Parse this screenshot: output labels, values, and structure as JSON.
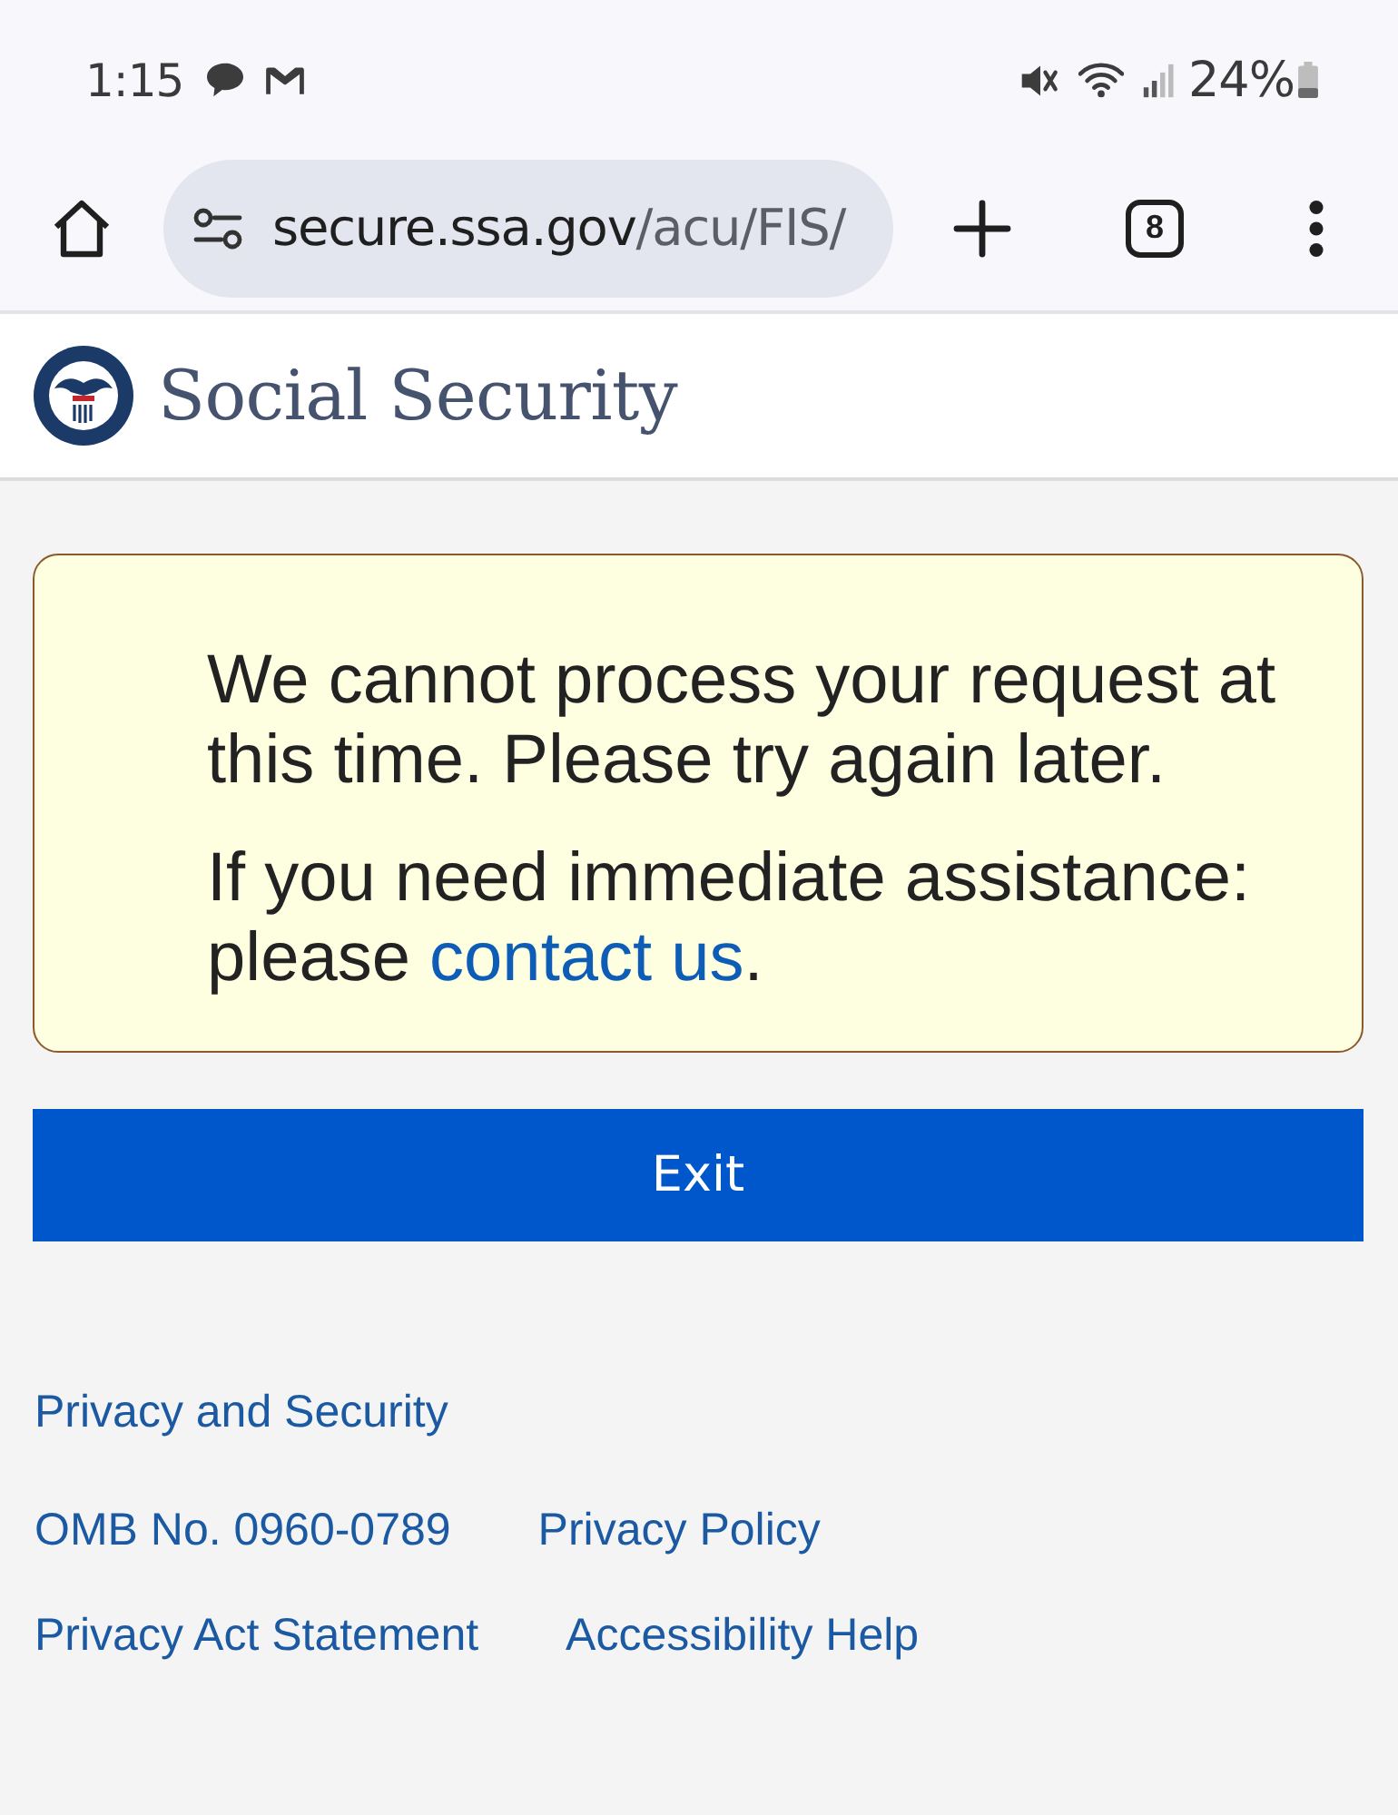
{
  "status_bar": {
    "time": "1:15",
    "battery": "24%"
  },
  "browser_toolbar": {
    "address_bar": {
      "host": "secure.ssa.gov",
      "path": "/acu/FIS/"
    },
    "tab_count": "8"
  },
  "site_header": {
    "title": "Social Security"
  },
  "alert": {
    "paragraphs": [
      {
        "segments": [
          {
            "kind": "text",
            "text": "We cannot process your request at this time. Please try again later."
          }
        ]
      },
      {
        "segments": [
          {
            "kind": "text",
            "text": "If you need immediate assistance: please "
          },
          {
            "kind": "link",
            "text": "contact us"
          },
          {
            "kind": "text",
            "text": "."
          }
        ]
      }
    ]
  },
  "exit_button": {
    "label": "Exit"
  },
  "footer": {
    "rows": [
      {
        "links": [
          {
            "label": "Privacy and Security"
          }
        ]
      },
      {
        "links": [
          {
            "label": "OMB No. 0960-0789"
          },
          {
            "label": "Privacy Policy"
          }
        ]
      },
      {
        "links": [
          {
            "label": "Privacy Act Statement"
          },
          {
            "label": "Accessibility Help"
          }
        ]
      }
    ]
  }
}
